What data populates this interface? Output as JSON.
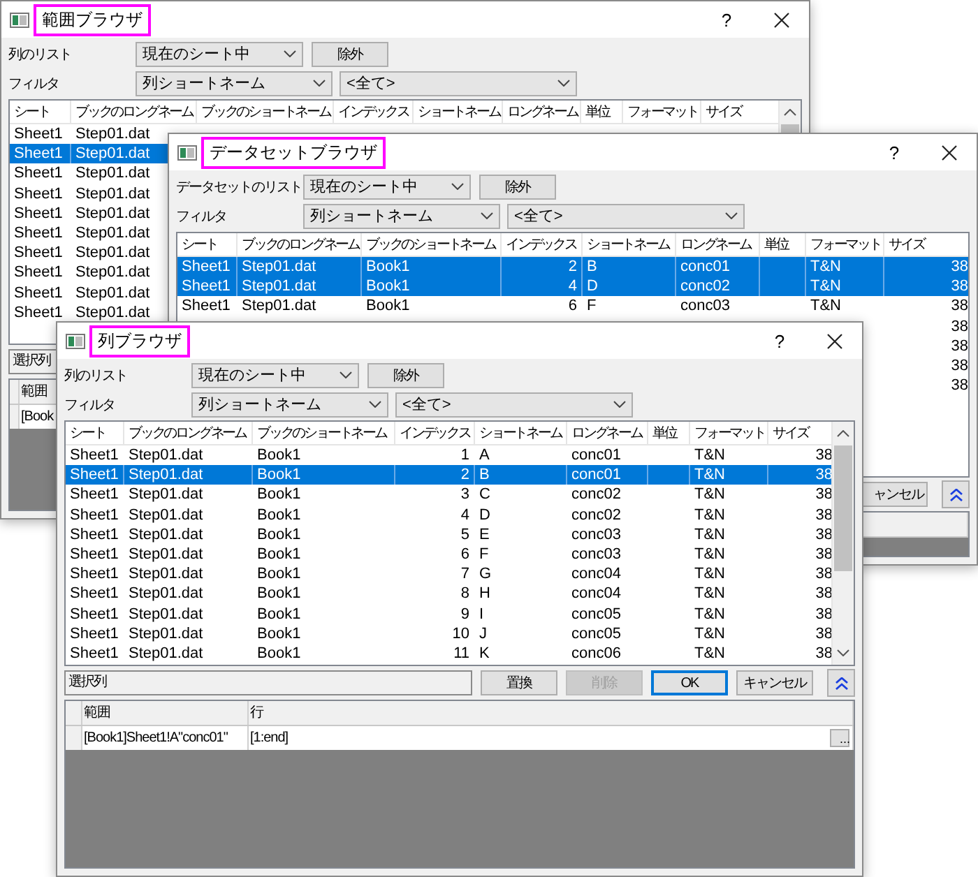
{
  "windows": [
    {
      "title": "範囲ブラウザ",
      "help": "?",
      "list_label": "列のリスト",
      "list_dropdown": "現在のシート中",
      "exclude_button": "除外",
      "filter_label": "フィルタ",
      "filter_dropdown": "列ショートネーム",
      "value_dropdown": "<全て>",
      "table": {
        "columns": [
          "シート",
          "ブックのロングネーム",
          "ブックのショートネーム",
          "インデックス",
          "ショートネーム",
          "ロングネーム",
          "単位",
          "フォーマット",
          "サイズ"
        ],
        "rows": [
          {
            "selected": false,
            "sheet": "Sheet1",
            "book_long_name": "Step01.dat"
          },
          {
            "selected": true,
            "sheet": "Sheet1",
            "book_long_name": "Step01.dat"
          },
          {
            "selected": false,
            "sheet": "Sheet1",
            "book_long_name": "Step01.dat"
          },
          {
            "selected": false,
            "sheet": "Sheet1",
            "book_long_name": "Step01.dat"
          },
          {
            "selected": false,
            "sheet": "Sheet1",
            "book_long_name": "Step01.dat"
          },
          {
            "selected": false,
            "sheet": "Sheet1",
            "book_long_name": "Step01.dat"
          },
          {
            "selected": false,
            "sheet": "Sheet1",
            "book_long_name": "Step01.dat"
          },
          {
            "selected": false,
            "sheet": "Sheet1",
            "book_long_name": "Step01.dat"
          },
          {
            "selected": false,
            "sheet": "Sheet1",
            "book_long_name": "Step01.dat"
          },
          {
            "selected": false,
            "sheet": "Sheet1",
            "book_long_name": "Step01.dat"
          }
        ]
      },
      "selection_field": "選択列",
      "range_grid": {
        "columns": [
          "範囲"
        ],
        "rows": [
          {
            "cells": [
              "[Book"
            ]
          }
        ]
      }
    },
    {
      "title": "データセットブラウザ",
      "help": "?",
      "list_label": "データセットのリスト",
      "list_dropdown": "現在のシート中",
      "exclude_button": "除外",
      "filter_label": "フィルタ",
      "filter_dropdown": "列ショートネーム",
      "value_dropdown": "<全て>",
      "table": {
        "columns": [
          "シート",
          "ブックのロングネーム",
          "ブックのショートネーム",
          "インデックス",
          "ショートネーム",
          "ロングネーム",
          "単位",
          "フォーマット",
          "サイズ"
        ],
        "rows": [
          {
            "selected": true,
            "sheet": "Sheet1",
            "book_long_name": "Step01.dat",
            "book_short_name": "Book1",
            "index": "2",
            "short_name": "B",
            "long_name": "conc01",
            "format": "T&N",
            "size": "38"
          },
          {
            "selected": true,
            "sheet": "Sheet1",
            "book_long_name": "Step01.dat",
            "book_short_name": "Book1",
            "index": "4",
            "short_name": "D",
            "long_name": "conc02",
            "format": "T&N",
            "size": "38"
          },
          {
            "selected": false,
            "sheet": "Sheet1",
            "book_long_name": "Step01.dat",
            "book_short_name": "Book1",
            "index": "6",
            "short_name": "F",
            "long_name": "conc03",
            "format": "T&N",
            "size": "38"
          },
          {
            "selected": false,
            "size": "38"
          },
          {
            "selected": false,
            "size": "38"
          },
          {
            "selected": false,
            "size": "38"
          },
          {
            "selected": false,
            "size": "38"
          }
        ]
      },
      "buttons": [
        {
          "label": "ャンセル",
          "disabled": false,
          "default": false
        }
      ],
      "collapse_button": true
    },
    {
      "title": "列ブラウザ",
      "help": "?",
      "list_label": "列のリスト",
      "list_dropdown": "現在のシート中",
      "exclude_button": "除外",
      "filter_label": "フィルタ",
      "filter_dropdown": "列ショートネーム",
      "value_dropdown": "<全て>",
      "table": {
        "columns": [
          "シート",
          "ブックのロングネーム",
          "ブックのショートネーム",
          "インデックス",
          "ショートネーム",
          "ロングネーム",
          "単位",
          "フォーマット",
          "サイズ"
        ],
        "rows": [
          {
            "selected": false,
            "sheet": "Sheet1",
            "book_long_name": "Step01.dat",
            "book_short_name": "Book1",
            "index": "1",
            "short_name": "A",
            "long_name": "conc01",
            "format": "T&N",
            "size": "38"
          },
          {
            "selected": true,
            "sheet": "Sheet1",
            "book_long_name": "Step01.dat",
            "book_short_name": "Book1",
            "index": "2",
            "short_name": "B",
            "long_name": "conc01",
            "format": "T&N",
            "size": "38"
          },
          {
            "selected": false,
            "sheet": "Sheet1",
            "book_long_name": "Step01.dat",
            "book_short_name": "Book1",
            "index": "3",
            "short_name": "C",
            "long_name": "conc02",
            "format": "T&N",
            "size": "38"
          },
          {
            "selected": false,
            "sheet": "Sheet1",
            "book_long_name": "Step01.dat",
            "book_short_name": "Book1",
            "index": "4",
            "short_name": "D",
            "long_name": "conc02",
            "format": "T&N",
            "size": "38"
          },
          {
            "selected": false,
            "sheet": "Sheet1",
            "book_long_name": "Step01.dat",
            "book_short_name": "Book1",
            "index": "5",
            "short_name": "E",
            "long_name": "conc03",
            "format": "T&N",
            "size": "38"
          },
          {
            "selected": false,
            "sheet": "Sheet1",
            "book_long_name": "Step01.dat",
            "book_short_name": "Book1",
            "index": "6",
            "short_name": "F",
            "long_name": "conc03",
            "format": "T&N",
            "size": "38"
          },
          {
            "selected": false,
            "sheet": "Sheet1",
            "book_long_name": "Step01.dat",
            "book_short_name": "Book1",
            "index": "7",
            "short_name": "G",
            "long_name": "conc04",
            "format": "T&N",
            "size": "38"
          },
          {
            "selected": false,
            "sheet": "Sheet1",
            "book_long_name": "Step01.dat",
            "book_short_name": "Book1",
            "index": "8",
            "short_name": "H",
            "long_name": "conc04",
            "format": "T&N",
            "size": "38"
          },
          {
            "selected": false,
            "sheet": "Sheet1",
            "book_long_name": "Step01.dat",
            "book_short_name": "Book1",
            "index": "9",
            "short_name": "I",
            "long_name": "conc05",
            "format": "T&N",
            "size": "38"
          },
          {
            "selected": false,
            "sheet": "Sheet1",
            "book_long_name": "Step01.dat",
            "book_short_name": "Book1",
            "index": "10",
            "short_name": "J",
            "long_name": "conc05",
            "format": "T&N",
            "size": "38"
          },
          {
            "selected": false,
            "sheet": "Sheet1",
            "book_long_name": "Step01.dat",
            "book_short_name": "Book1",
            "index": "11",
            "short_name": "K",
            "long_name": "conc06",
            "format": "T&N",
            "size": "38"
          }
        ]
      },
      "selection_field": "選択列",
      "buttons": [
        {
          "label": "置換",
          "disabled": false,
          "default": false
        },
        {
          "label": "削除",
          "disabled": true,
          "default": false
        },
        {
          "label": "OK",
          "disabled": false,
          "default": true
        },
        {
          "label": "キャンセル",
          "disabled": false,
          "default": false
        }
      ],
      "collapse_button": true,
      "range_grid": {
        "columns": [
          "範囲",
          "行"
        ],
        "rows": [
          {
            "cells": [
              "[Book1]Sheet1!A\"conc01\"",
              "[1:end]"
            ],
            "browse_button": "..."
          }
        ]
      }
    }
  ]
}
